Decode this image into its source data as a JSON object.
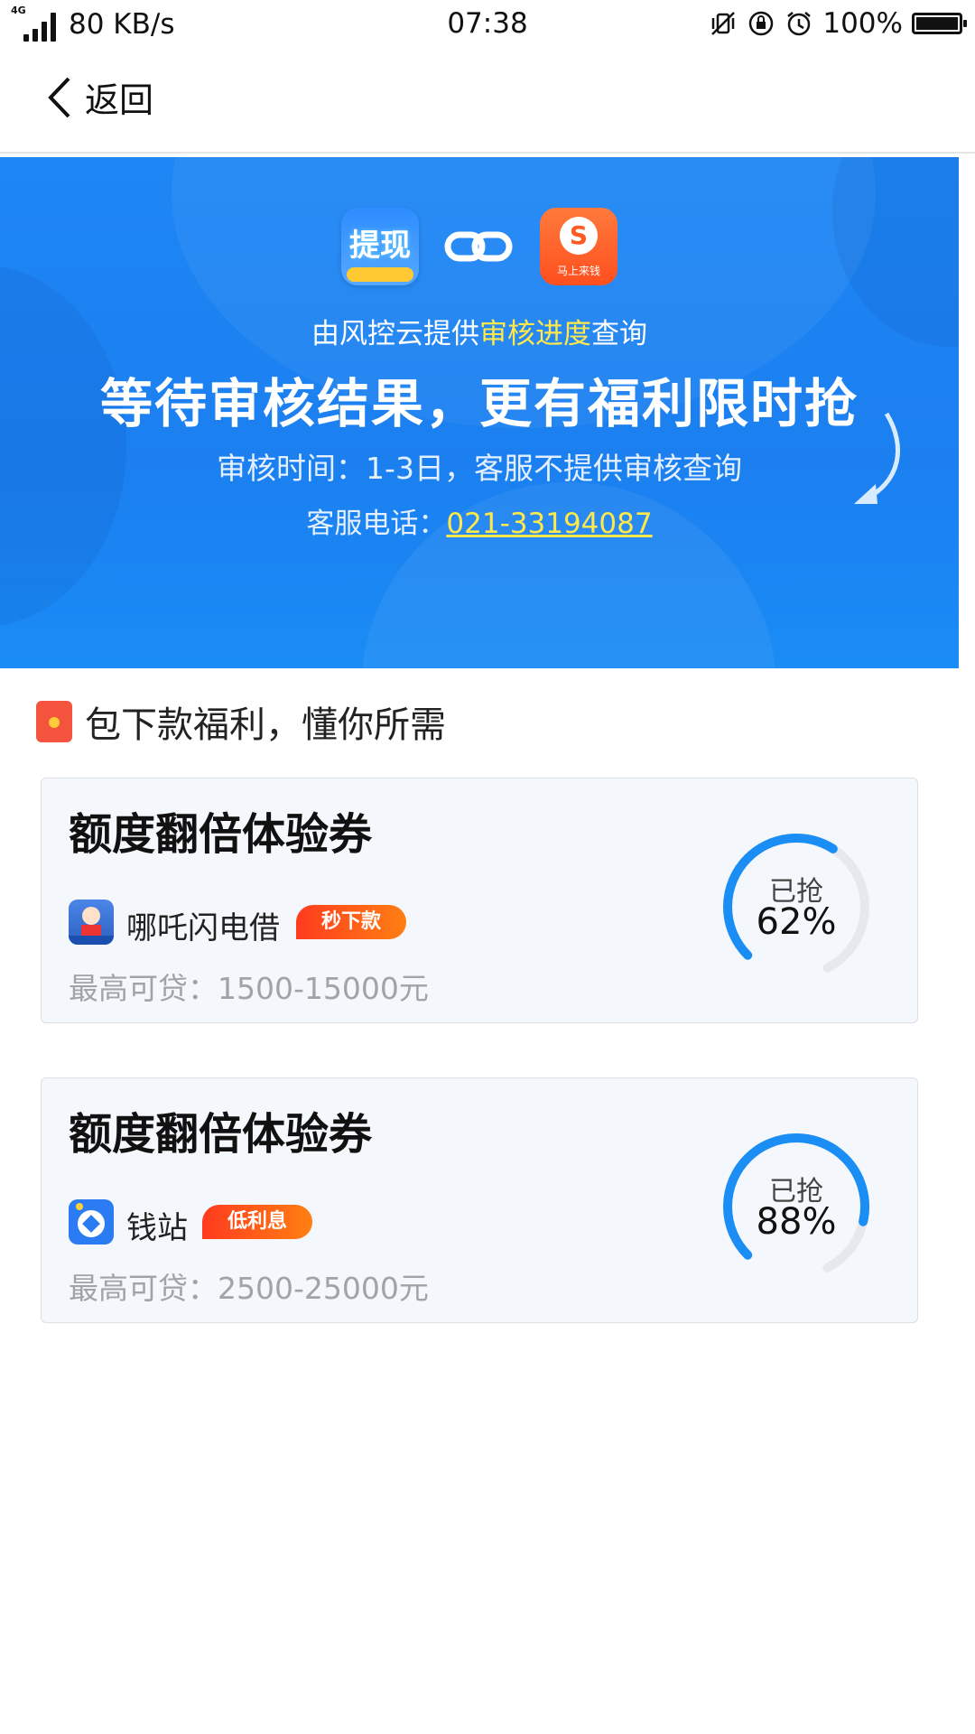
{
  "status_bar": {
    "network_type": "4G",
    "speed": "80 KB/s",
    "time": "07:38",
    "battery": "100%",
    "icons": [
      "vibrate-off-icon",
      "rotation-lock-icon",
      "alarm-icon",
      "battery-icon"
    ]
  },
  "nav": {
    "back_label": "返回"
  },
  "banner": {
    "logo_left_text": "提现",
    "logo_right_caption": "马上来钱",
    "subtitle_pre": "由风控云提供",
    "subtitle_highlight": "审核进度",
    "subtitle_post": "查询",
    "headline": "等待审核结果，更有福利限时抢",
    "review_time": "审核时间：1-3日，客服不提供审核查询",
    "phone_label": "客服电话：",
    "phone_number": "021-33194087",
    "colors": {
      "background": "#1b7ff0",
      "highlight": "#ffe84a"
    }
  },
  "section": {
    "title": "包下款福利，懂你所需"
  },
  "cards": [
    {
      "title": "额度翻倍体验券",
      "app_name": "哪吒闪电借",
      "tag": "秒下款",
      "limit": "最高可贷：1500-15000元",
      "grabbed_label": "已抢",
      "grabbed_percent": "62%",
      "progress": 0.62
    },
    {
      "title": "额度翻倍体验券",
      "app_name": "钱站",
      "tag": "低利息",
      "limit": "最高可贷：2500-25000元",
      "grabbed_label": "已抢",
      "grabbed_percent": "88%",
      "progress": 0.88
    }
  ]
}
